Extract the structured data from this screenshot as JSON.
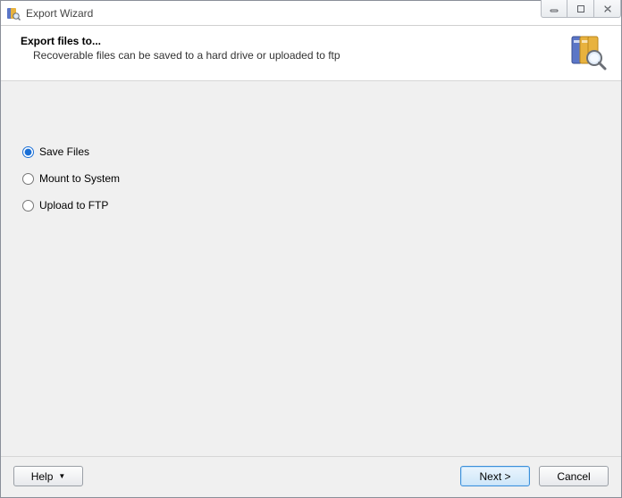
{
  "window": {
    "title": "Export Wizard"
  },
  "header": {
    "title": "Export files to...",
    "subtitle": "Recoverable files can be saved to a hard drive or uploaded to ftp"
  },
  "options": {
    "save_files": "Save Files",
    "mount_to_system": "Mount to System",
    "upload_to_ftp": "Upload to FTP",
    "selected": "save_files"
  },
  "footer": {
    "help": "Help",
    "next": "Next >",
    "cancel": "Cancel"
  }
}
